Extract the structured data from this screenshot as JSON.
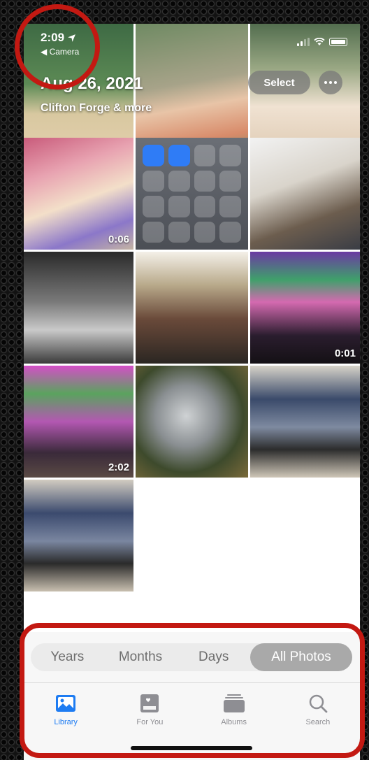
{
  "status_bar": {
    "time": "2:09",
    "back_label": "Camera"
  },
  "header": {
    "date": "Aug 26, 2021",
    "location": "Clifton Forge & more"
  },
  "actions": {
    "select": "Select"
  },
  "grid": {
    "durations": [
      "0:06",
      "0:01",
      "2:02"
    ]
  },
  "view_switcher": {
    "options": [
      "Years",
      "Months",
      "Days",
      "All Photos"
    ],
    "selected": "All Photos"
  },
  "tab_bar": {
    "tabs": [
      {
        "label": "Library",
        "icon": "library-icon"
      },
      {
        "label": "For You",
        "icon": "for-you-icon"
      },
      {
        "label": "Albums",
        "icon": "albums-icon"
      },
      {
        "label": "Search",
        "icon": "search-icon"
      }
    ],
    "active": "Library"
  },
  "colors": {
    "accent": "#1e7cf2",
    "highlight": "#c31912"
  }
}
